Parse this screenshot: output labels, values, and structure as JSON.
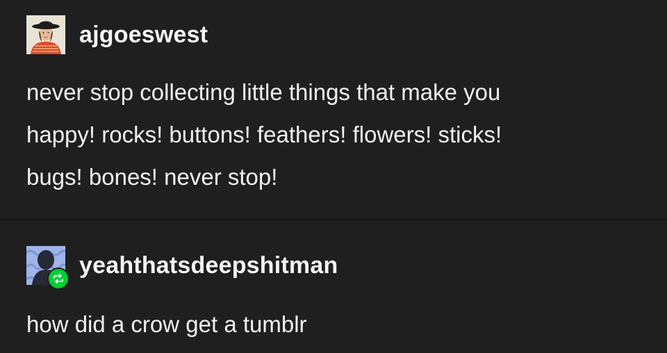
{
  "posts": [
    {
      "username": "ajgoeswest",
      "avatar_icon": "user-photo-avatar",
      "lines": [
        "never stop collecting little things that make you",
        "happy! rocks! buttons! feathers! flowers! sticks!",
        "bugs! bones! never stop!"
      ]
    },
    {
      "username": "yeahthatsdeepshitman",
      "avatar_icon": "silhouette-avatar",
      "badge_icon": "reblog-icon",
      "lines": [
        "how did a crow get a tumblr"
      ]
    }
  ],
  "colors": {
    "background": "#1f1f1f",
    "text": "#f1f1f1",
    "reblog_badge": "#00cf35"
  }
}
